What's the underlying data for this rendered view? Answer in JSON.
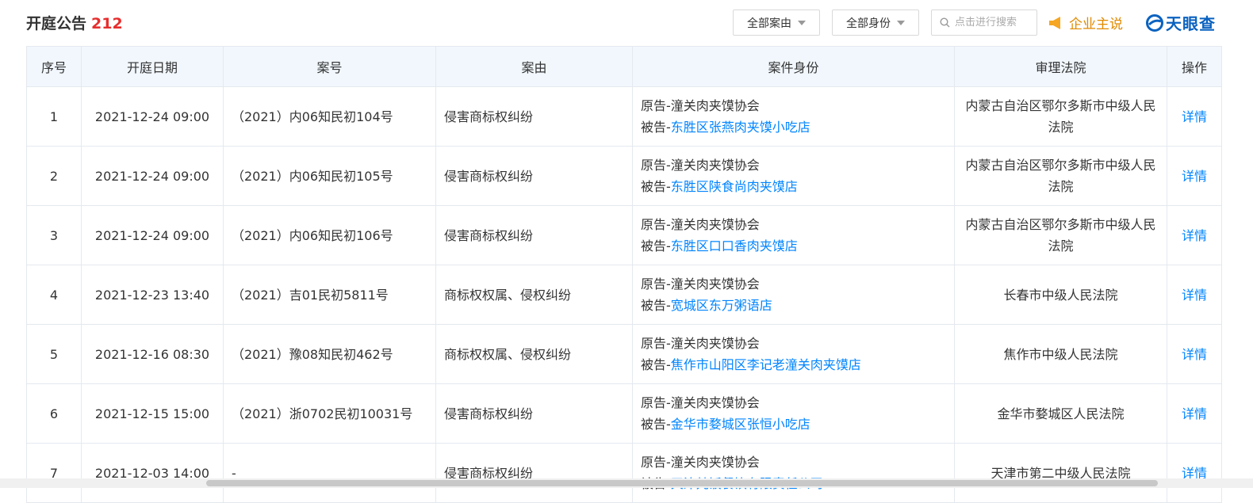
{
  "header": {
    "title": "开庭公告",
    "count": "212",
    "filter_cause": "全部案由",
    "filter_role": "全部身份",
    "search_placeholder": "点击进行搜索",
    "enterprise_label": "企业主说",
    "logo_text": "天眼查"
  },
  "table": {
    "columns": [
      "序号",
      "开庭日期",
      "案号",
      "案由",
      "案件身份",
      "审理法院",
      "操作"
    ],
    "rows": [
      {
        "no": "1",
        "date": "2021-12-24 09:00",
        "case_no": "（2021）内06知民初104号",
        "cause": "侵害商标权纠纷",
        "plaintiff_prefix": "原告-",
        "plaintiff": "潼关肉夹馍协会",
        "defendant_prefix": "被告-",
        "defendant": "东胜区张燕肉夹馍小吃店",
        "court": "内蒙古自治区鄂尔多斯市中级人民法院",
        "action": "详情"
      },
      {
        "no": "2",
        "date": "2021-12-24 09:00",
        "case_no": "（2021）内06知民初105号",
        "cause": "侵害商标权纠纷",
        "plaintiff_prefix": "原告-",
        "plaintiff": "潼关肉夹馍协会",
        "defendant_prefix": "被告-",
        "defendant": "东胜区陕食尚肉夹馍店",
        "court": "内蒙古自治区鄂尔多斯市中级人民法院",
        "action": "详情"
      },
      {
        "no": "3",
        "date": "2021-12-24 09:00",
        "case_no": "（2021）内06知民初106号",
        "cause": "侵害商标权纠纷",
        "plaintiff_prefix": "原告-",
        "plaintiff": "潼关肉夹馍协会",
        "defendant_prefix": "被告-",
        "defendant": "东胜区口口香肉夹馍店",
        "court": "内蒙古自治区鄂尔多斯市中级人民法院",
        "action": "详情"
      },
      {
        "no": "4",
        "date": "2021-12-23 13:40",
        "case_no": "（2021）吉01民初5811号",
        "cause": "商标权权属、侵权纠纷",
        "plaintiff_prefix": "原告-",
        "plaintiff": "潼关肉夹馍协会",
        "defendant_prefix": "被告-",
        "defendant": "宽城区东万粥语店",
        "court": "长春市中级人民法院",
        "action": "详情"
      },
      {
        "no": "5",
        "date": "2021-12-16 08:30",
        "case_no": "（2021）豫08知民初462号",
        "cause": "商标权权属、侵权纠纷",
        "plaintiff_prefix": "原告-",
        "plaintiff": "潼关肉夹馍协会",
        "defendant_prefix": "被告-",
        "defendant": "焦作市山阳区李记老潼关肉夹馍店",
        "court": "焦作市中级人民法院",
        "action": "详情"
      },
      {
        "no": "6",
        "date": "2021-12-15 15:00",
        "case_no": "（2021）浙0702民初10031号",
        "cause": "侵害商标权纠纷",
        "plaintiff_prefix": "原告-",
        "plaintiff": "潼关肉夹馍协会",
        "defendant_prefix": "被告-",
        "defendant": "金华市婺城区张恒小吃店",
        "court": "金华市婺城区人民法院",
        "action": "详情"
      },
      {
        "no": "7",
        "date": "2021-12-03 14:00",
        "case_no": "-",
        "cause": "侵害商标权纠纷",
        "plaintiff_prefix": "原告-",
        "plaintiff": "潼关肉夹馍协会",
        "defendant_prefix": "被告-",
        "defendant": "天津梵饭餐饮有限责任公司",
        "court": "天津市第二中级人民法院",
        "action": "详情"
      }
    ]
  },
  "colors": {
    "accent": "#0084ff",
    "count": "#e62e2e",
    "enterprise": "#e08a00",
    "header_bg": "#f1f7fd"
  }
}
